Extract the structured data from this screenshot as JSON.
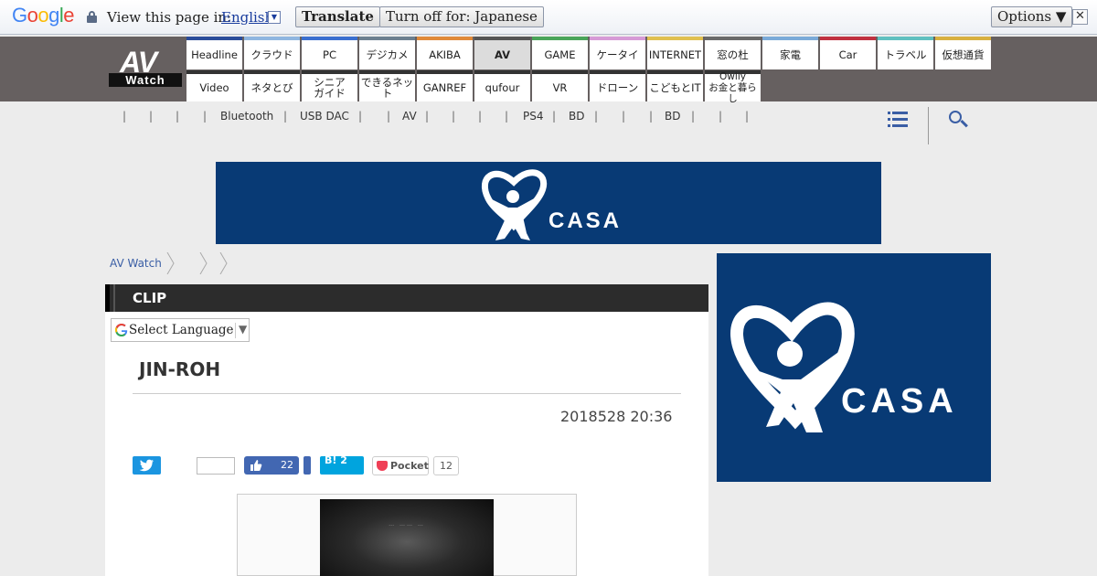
{
  "translate_bar": {
    "view_label": "View this page in:",
    "language": "English",
    "translate_btn": "Translate",
    "turn_off_btn": "Turn off for: Japanese",
    "options_btn": "Options ▼",
    "close_glyph": "✕"
  },
  "site": {
    "logo_top": "AV",
    "logo_bottom": "Watch"
  },
  "nav": {
    "row1": [
      "Headline",
      "クラウド",
      "PC",
      "デジカメ",
      "AKIBA",
      "AV",
      "GAME",
      "ケータイ",
      "INTERNET",
      "窓の杜",
      "家電",
      "Car",
      "トラベル",
      "仮想通貨"
    ],
    "row1_colors": [
      "#2a4c9a",
      "#8fb6e0",
      "#3a6fd0",
      "#6b7f90",
      "#e08a3a",
      "#555555",
      "#4aa55a",
      "#d69ad6",
      "#e0c050",
      "#6a6a6a",
      "#7aaad8",
      "#c03040",
      "#60c0c0",
      "#d8b040"
    ],
    "row2": [
      "Video",
      "ネタとび",
      "シニア\nガイド",
      "できるネット",
      "GANREF",
      "qufour",
      "VR",
      "ドローン",
      "こどもとIT",
      "Owlly\nお金と暮らし"
    ],
    "active": "AV"
  },
  "subnav": {
    "links": [
      "Bluetooth",
      "USB DAC",
      "AV",
      "PS4",
      "BD",
      "BD"
    ]
  },
  "breadcrumb": {
    "home": "AV Watch"
  },
  "article": {
    "category": "CLIP",
    "select_language": "Select Language",
    "title": "JIN-ROH",
    "date": "2018528 20:36",
    "fb_count": "22",
    "hatena_label": "B! 2",
    "pocket_label": "Pocket",
    "pocket_count": "12",
    "photo_caption": "… …… …"
  },
  "ads": {
    "brand": "CASA"
  },
  "colors": {
    "ad_bg": "#083a75",
    "link": "#3a5ea5",
    "twitter": "#1b95e0",
    "facebook": "#4267b2",
    "hatena": "#00a4de",
    "pocket": "#ef3f56"
  }
}
